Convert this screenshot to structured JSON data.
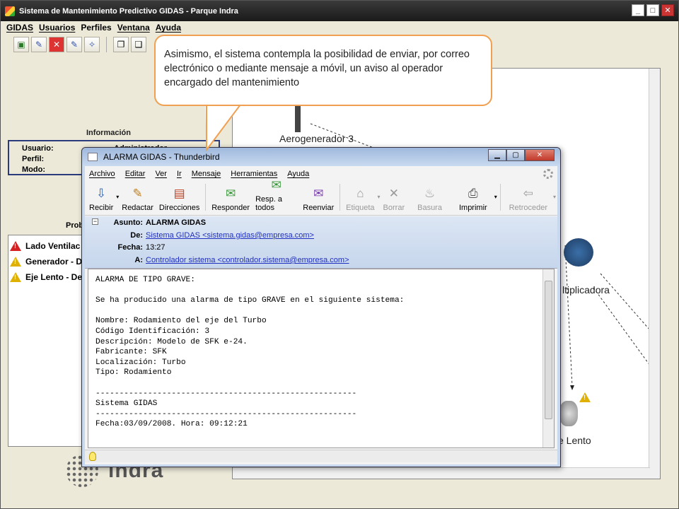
{
  "app": {
    "title": "Sistema de Mantenimiento Predictivo GIDAS - Parque Indra",
    "menu": [
      "GIDAS",
      "Usuarios",
      "Perfiles",
      "Ventana",
      "Ayuda"
    ],
    "window_buttons": [
      "_",
      "□",
      "✕"
    ]
  },
  "info": {
    "title": "Información",
    "rows": [
      {
        "label": "Usuario:",
        "value": "Administrador"
      },
      {
        "label": "Perfil:",
        "value": ""
      },
      {
        "label": "Modo:",
        "value": ""
      }
    ]
  },
  "problems": {
    "title": "Prob",
    "items": [
      {
        "label": "Lado Ventilac",
        "severity": "red"
      },
      {
        "label": "Generador - D",
        "severity": "yellow"
      },
      {
        "label": "Eje Lento - De",
        "severity": "yellow"
      }
    ]
  },
  "diagram": {
    "labels": [
      "Aerogenerador 3",
      "ltiplicadora",
      "e Lento"
    ]
  },
  "callout": {
    "text": "Asimismo, el sistema contempla la posibilidad de enviar, por correo electrónico o mediante mensaje a móvil, un aviso al operador encargado del mantenimiento"
  },
  "thunderbird": {
    "title": "ALARMA GIDAS - Thunderbird",
    "menu": [
      "Archivo",
      "Editar",
      "Ver",
      "Ir",
      "Mensaje",
      "Herramientas",
      "Ayuda"
    ],
    "tools": [
      {
        "label": "Recibir",
        "icon": "receive-icon",
        "enabled": true
      },
      {
        "label": "Redactar",
        "icon": "pencil-icon",
        "enabled": true
      },
      {
        "label": "Direcciones",
        "icon": "address-book-icon",
        "enabled": true
      },
      {
        "label": "Responder",
        "icon": "reply-icon",
        "enabled": true
      },
      {
        "label": "Resp. a todos",
        "icon": "reply-all-icon",
        "enabled": true
      },
      {
        "label": "Reenviar",
        "icon": "forward-icon",
        "enabled": true
      },
      {
        "label": "Etiqueta",
        "icon": "tag-icon",
        "enabled": false
      },
      {
        "label": "Borrar",
        "icon": "delete-icon",
        "enabled": false
      },
      {
        "label": "Basura",
        "icon": "junk-icon",
        "enabled": false
      },
      {
        "label": "Imprimir",
        "icon": "print-icon",
        "enabled": true
      },
      {
        "label": "Retroceder",
        "icon": "back-icon",
        "enabled": false
      }
    ],
    "header": {
      "subject_label": "Asunto:",
      "subject": "ALARMA GIDAS",
      "from_label": "De:",
      "from": "Sistema GIDAS <sistema.gidas@empresa.com>",
      "date_label": "Fecha:",
      "date": "13:27",
      "to_label": "A:",
      "to": "Controlador sistema <controlador.sistema@empresa.com>"
    },
    "body": "ALARMA DE TIPO GRAVE:\n\nSe ha producido una alarma de tipo GRAVE en el siguiente sistema:\n\nNombre: Rodamiento del eje del Turbo\nCódigo Identificación: 3\nDescripción: Modelo de SFK e-24.\nFabricante: SFK\nLocalización: Turbo\nTipo: Rodamiento\n\n-------------------------------------------------------\nSistema GIDAS\n-------------------------------------------------------\nFecha:03/09/2008. Hora: 09:12:21"
  },
  "branding": {
    "logo_text": "indra"
  },
  "colors": {
    "callout_border": "#f0a050",
    "link": "#2030c0",
    "info_border": "#2a3a7a"
  }
}
